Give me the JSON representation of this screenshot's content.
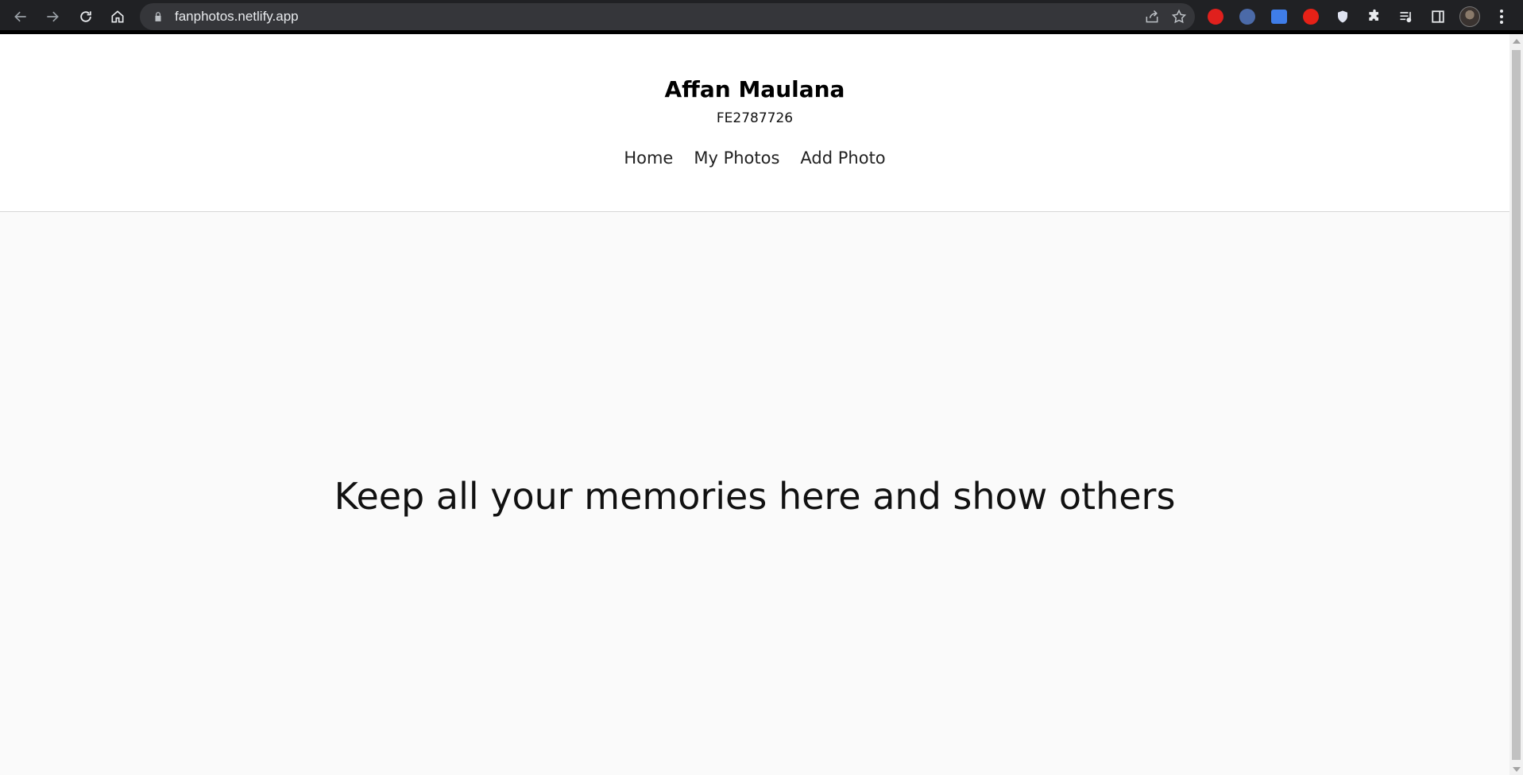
{
  "browser": {
    "url": "fanphotos.netlify.app",
    "icons": {
      "back": "back-arrow-icon",
      "forward": "forward-arrow-icon",
      "reload": "reload-icon",
      "home": "home-icon",
      "lock": "lock-icon",
      "share": "share-icon",
      "bookmark": "star-icon",
      "extensions": [
        "adblock-icon",
        "cursor-icon",
        "translate-icon",
        "youtube-icon",
        "shield-icon",
        "puzzle-icon",
        "media-queue-icon",
        "side-panel-icon"
      ],
      "menu": "kebab-menu-icon"
    }
  },
  "site": {
    "title": "Affan Maulana",
    "subtitle": "FE2787726",
    "nav": [
      {
        "label": "Home"
      },
      {
        "label": "My Photos"
      },
      {
        "label": "Add Photo"
      }
    ],
    "hero_text": "Keep all your memories here and show others"
  }
}
